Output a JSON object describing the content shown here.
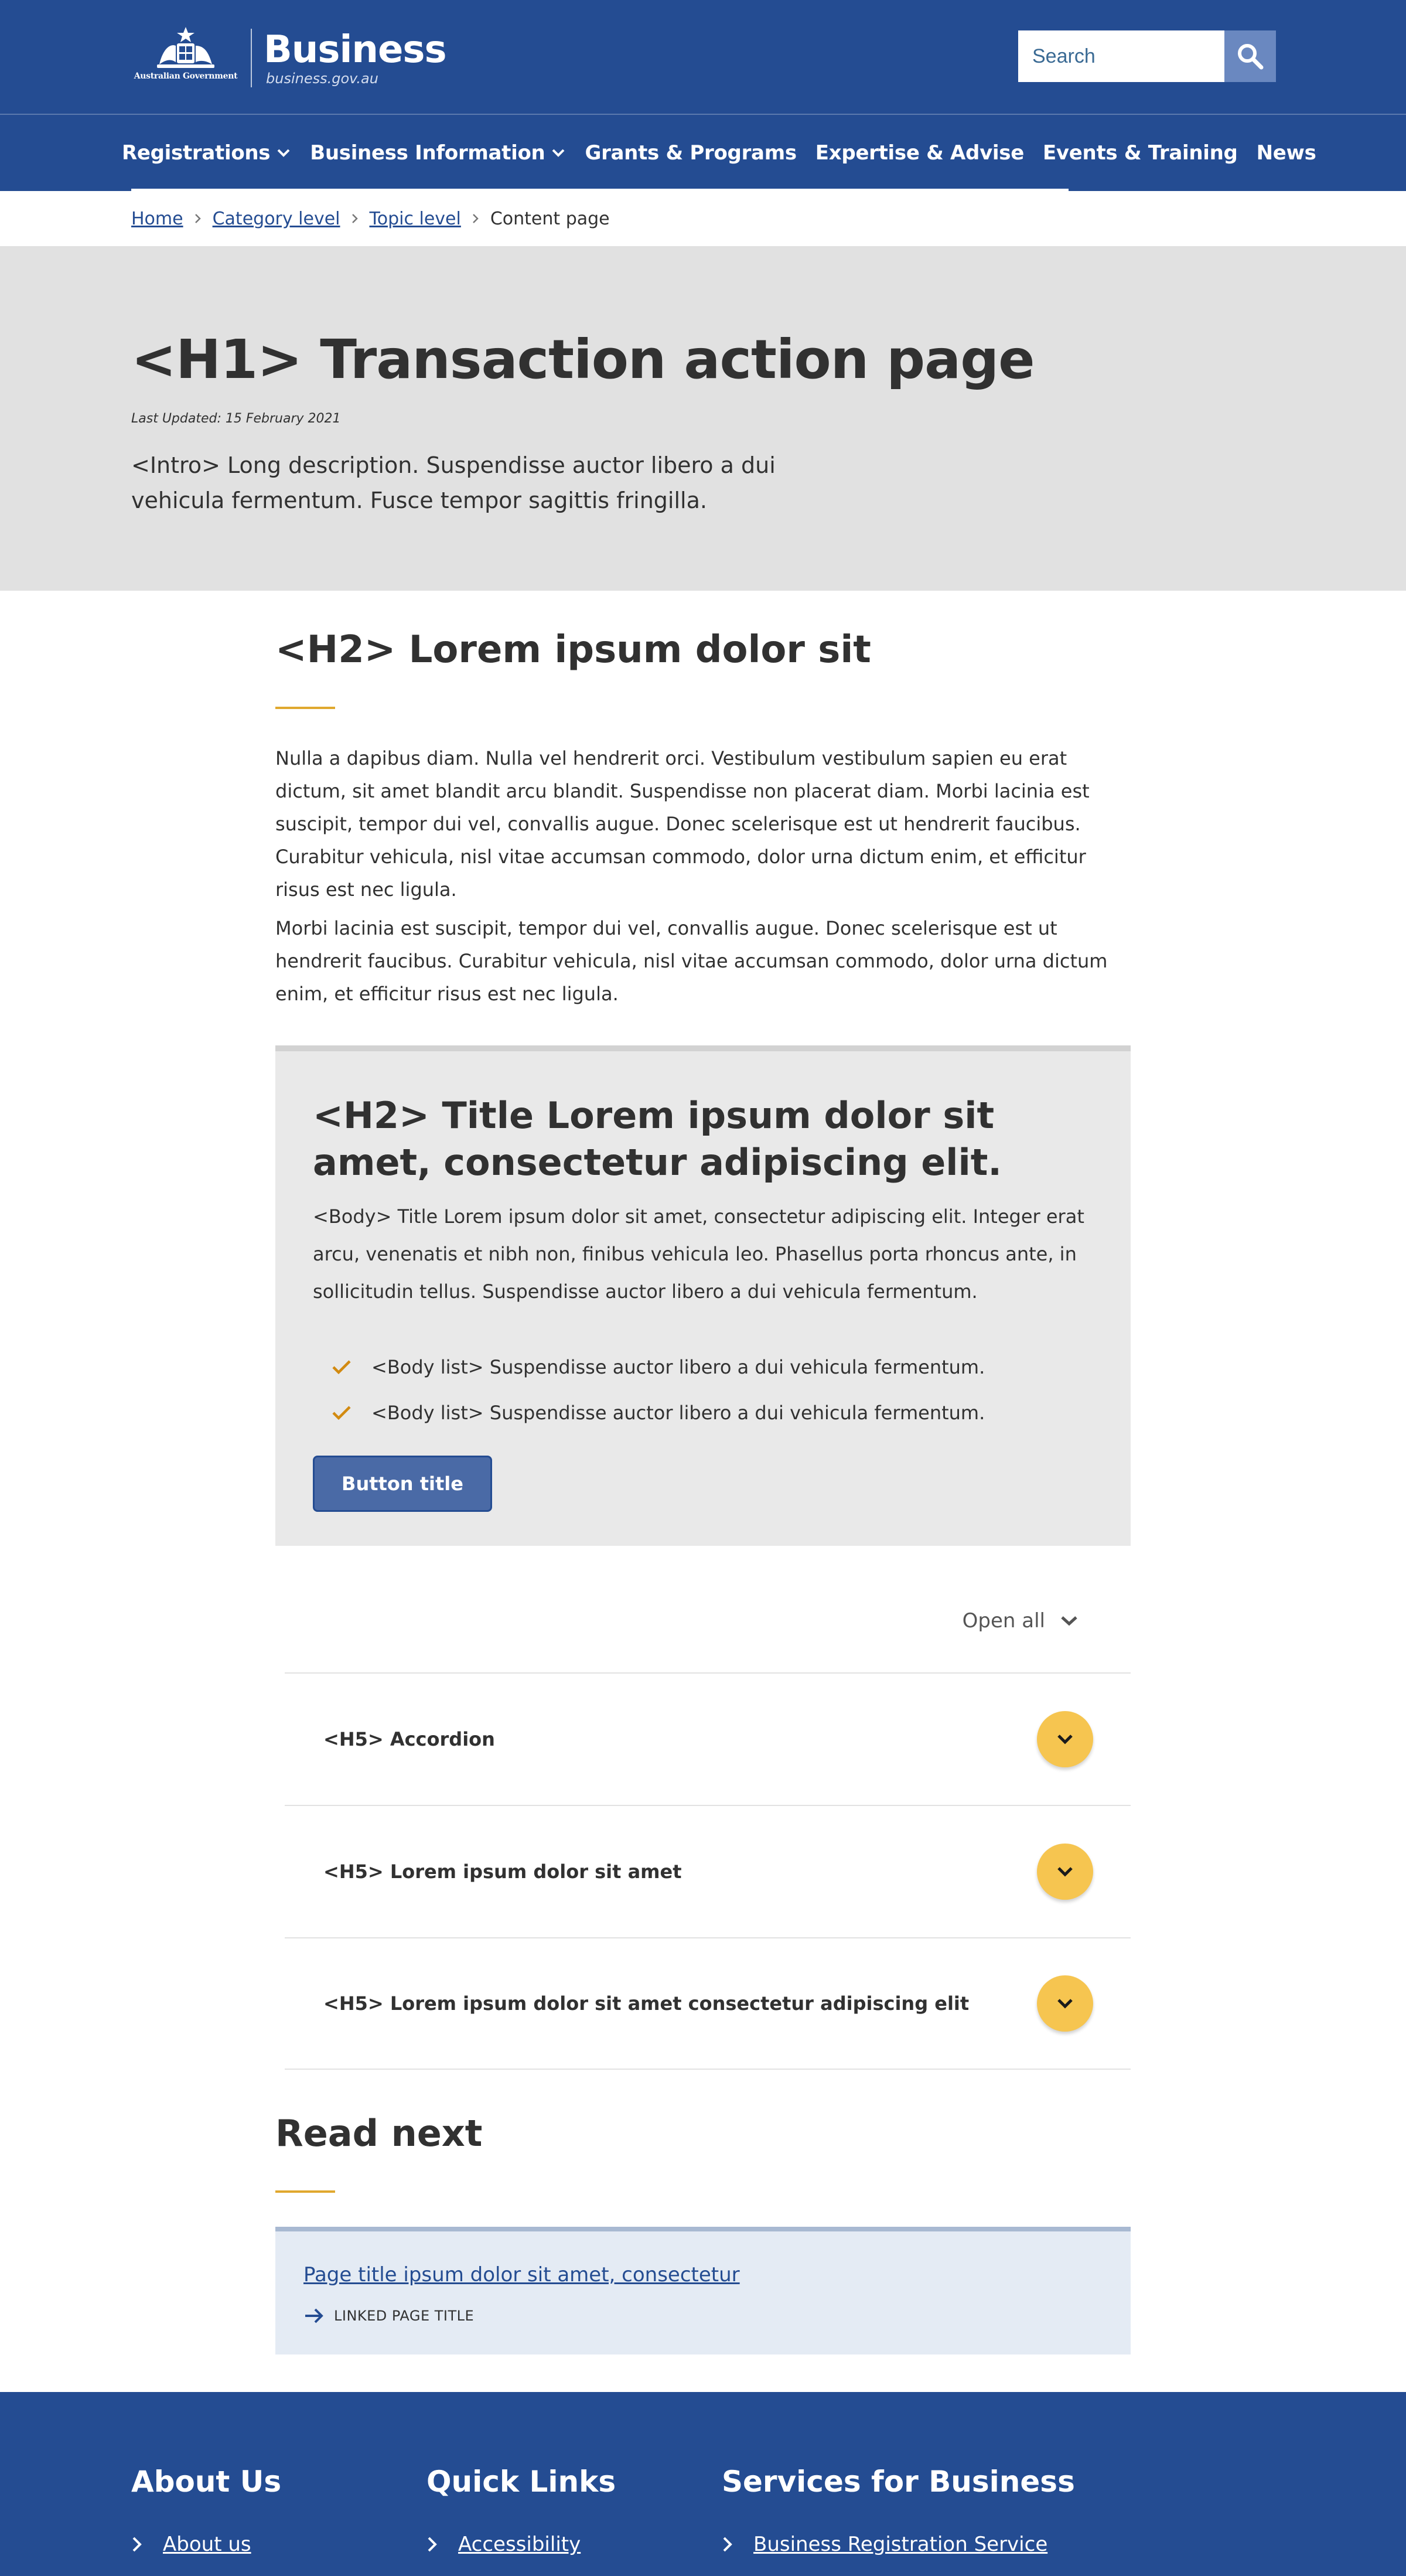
{
  "header": {
    "gov_label": "Australian Government",
    "brand_name": "Business",
    "brand_url": "business.gov.au",
    "search_placeholder": "Search",
    "search_icon": "search-icon"
  },
  "nav": {
    "items": [
      {
        "label": "Registrations",
        "has_dropdown": true
      },
      {
        "label": "Business Information",
        "has_dropdown": true
      },
      {
        "label": "Grants & Programs",
        "has_dropdown": false
      },
      {
        "label": "Expertise & Advise",
        "has_dropdown": false
      },
      {
        "label": "Events & Training",
        "has_dropdown": false
      },
      {
        "label": "News",
        "has_dropdown": false
      }
    ]
  },
  "breadcrumb": {
    "items": [
      "Home",
      "Category level",
      "Topic level"
    ],
    "current": "Content page"
  },
  "hero": {
    "title": "<H1> Transaction action page",
    "last_updated": "Last Updated: 15 February 2021",
    "intro": "<Intro> Long description. Suspendisse auctor libero a dui vehicula fermentum. Fusce tempor sagittis fringilla."
  },
  "section": {
    "heading": "<H2> Lorem ipsum dolor sit",
    "paragraph_1": "Nulla a dapibus diam. Nulla vel hendrerit orci. Vestibulum vestibulum sapien eu erat dictum, sit amet blandit arcu blandit. Suspendisse non placerat diam. Morbi lacinia est suscipit, tempor dui vel, convallis augue. Donec scelerisque est ut hendrerit faucibus. Curabitur vehicula, nisl vitae accumsan commodo, dolor urna dictum enim, et efficitur risus est nec ligula.",
    "paragraph_2": "Morbi lacinia est suscipit, tempor dui vel, convallis augue. Donec scelerisque est ut hendrerit faucibus. Curabitur vehicula, nisl vitae accumsan commodo, dolor urna dictum enim, et efficitur risus est nec ligula."
  },
  "callout": {
    "title": "<H2> Title Lorem ipsum dolor sit amet, consectetur adipiscing elit.",
    "body": "<Body> Title Lorem ipsum dolor sit amet, consectetur adipiscing elit. Integer erat arcu, venenatis et nibh non, finibus vehicula leo. Phasellus porta rhoncus ante, in sollicitudin tellus. Suspendisse auctor libero a dui vehicula fermentum.",
    "list": [
      "<Body list> Suspendisse auctor libero a dui vehicula fermentum.",
      "<Body list> Suspendisse auctor libero a dui vehicula fermentum."
    ],
    "button_label": "Button title"
  },
  "accordion": {
    "open_all_label": "Open all",
    "items": [
      {
        "title": "<H5> Accordion"
      },
      {
        "title": "<H5> Lorem ipsum dolor sit amet"
      },
      {
        "title": "<H5> Lorem ipsum dolor sit amet consectetur adipiscing elit"
      }
    ]
  },
  "read_next": {
    "heading": "Read next",
    "card": {
      "link": "Page title ipsum dolor sit amet, consectetur",
      "meta": "LINKED PAGE TITLE"
    }
  },
  "footer": {
    "columns": [
      {
        "heading": "About Us",
        "link": "About us"
      },
      {
        "heading": "Quick Links",
        "link": "Accessibility"
      },
      {
        "heading": "Services for Business",
        "link": "Business Registration Service"
      }
    ]
  },
  "colors": {
    "brand_blue": "#244c92",
    "accent_gold": "#e0a82e",
    "accordion_toggle": "#f6c550",
    "hero_grey": "#e1e1e1",
    "callout_grey": "#e9e9e9",
    "card_blue": "#e4ebf4"
  }
}
